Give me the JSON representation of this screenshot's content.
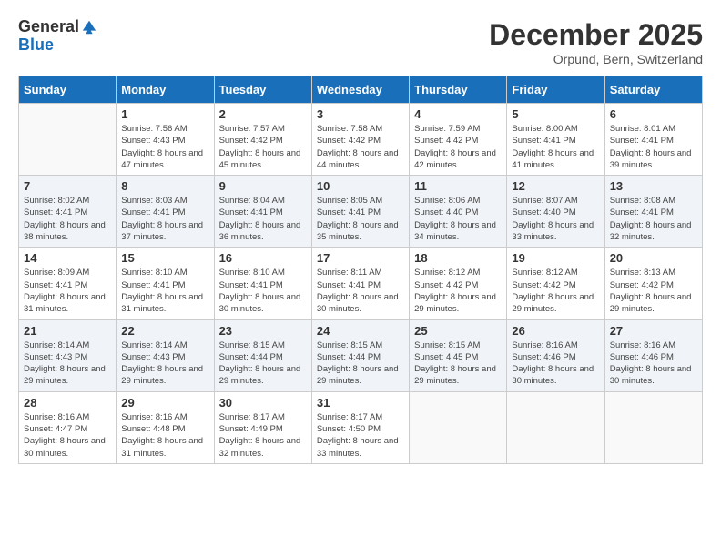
{
  "logo": {
    "general": "General",
    "blue": "Blue"
  },
  "title": "December 2025",
  "location": "Orpund, Bern, Switzerland",
  "days_of_week": [
    "Sunday",
    "Monday",
    "Tuesday",
    "Wednesday",
    "Thursday",
    "Friday",
    "Saturday"
  ],
  "weeks": [
    [
      {
        "day": "",
        "sunrise": "",
        "sunset": "",
        "daylight": ""
      },
      {
        "day": "1",
        "sunrise": "Sunrise: 7:56 AM",
        "sunset": "Sunset: 4:43 PM",
        "daylight": "Daylight: 8 hours and 47 minutes."
      },
      {
        "day": "2",
        "sunrise": "Sunrise: 7:57 AM",
        "sunset": "Sunset: 4:42 PM",
        "daylight": "Daylight: 8 hours and 45 minutes."
      },
      {
        "day": "3",
        "sunrise": "Sunrise: 7:58 AM",
        "sunset": "Sunset: 4:42 PM",
        "daylight": "Daylight: 8 hours and 44 minutes."
      },
      {
        "day": "4",
        "sunrise": "Sunrise: 7:59 AM",
        "sunset": "Sunset: 4:42 PM",
        "daylight": "Daylight: 8 hours and 42 minutes."
      },
      {
        "day": "5",
        "sunrise": "Sunrise: 8:00 AM",
        "sunset": "Sunset: 4:41 PM",
        "daylight": "Daylight: 8 hours and 41 minutes."
      },
      {
        "day": "6",
        "sunrise": "Sunrise: 8:01 AM",
        "sunset": "Sunset: 4:41 PM",
        "daylight": "Daylight: 8 hours and 39 minutes."
      }
    ],
    [
      {
        "day": "7",
        "sunrise": "Sunrise: 8:02 AM",
        "sunset": "Sunset: 4:41 PM",
        "daylight": "Daylight: 8 hours and 38 minutes."
      },
      {
        "day": "8",
        "sunrise": "Sunrise: 8:03 AM",
        "sunset": "Sunset: 4:41 PM",
        "daylight": "Daylight: 8 hours and 37 minutes."
      },
      {
        "day": "9",
        "sunrise": "Sunrise: 8:04 AM",
        "sunset": "Sunset: 4:41 PM",
        "daylight": "Daylight: 8 hours and 36 minutes."
      },
      {
        "day": "10",
        "sunrise": "Sunrise: 8:05 AM",
        "sunset": "Sunset: 4:41 PM",
        "daylight": "Daylight: 8 hours and 35 minutes."
      },
      {
        "day": "11",
        "sunrise": "Sunrise: 8:06 AM",
        "sunset": "Sunset: 4:40 PM",
        "daylight": "Daylight: 8 hours and 34 minutes."
      },
      {
        "day": "12",
        "sunrise": "Sunrise: 8:07 AM",
        "sunset": "Sunset: 4:40 PM",
        "daylight": "Daylight: 8 hours and 33 minutes."
      },
      {
        "day": "13",
        "sunrise": "Sunrise: 8:08 AM",
        "sunset": "Sunset: 4:41 PM",
        "daylight": "Daylight: 8 hours and 32 minutes."
      }
    ],
    [
      {
        "day": "14",
        "sunrise": "Sunrise: 8:09 AM",
        "sunset": "Sunset: 4:41 PM",
        "daylight": "Daylight: 8 hours and 31 minutes."
      },
      {
        "day": "15",
        "sunrise": "Sunrise: 8:10 AM",
        "sunset": "Sunset: 4:41 PM",
        "daylight": "Daylight: 8 hours and 31 minutes."
      },
      {
        "day": "16",
        "sunrise": "Sunrise: 8:10 AM",
        "sunset": "Sunset: 4:41 PM",
        "daylight": "Daylight: 8 hours and 30 minutes."
      },
      {
        "day": "17",
        "sunrise": "Sunrise: 8:11 AM",
        "sunset": "Sunset: 4:41 PM",
        "daylight": "Daylight: 8 hours and 30 minutes."
      },
      {
        "day": "18",
        "sunrise": "Sunrise: 8:12 AM",
        "sunset": "Sunset: 4:42 PM",
        "daylight": "Daylight: 8 hours and 29 minutes."
      },
      {
        "day": "19",
        "sunrise": "Sunrise: 8:12 AM",
        "sunset": "Sunset: 4:42 PM",
        "daylight": "Daylight: 8 hours and 29 minutes."
      },
      {
        "day": "20",
        "sunrise": "Sunrise: 8:13 AM",
        "sunset": "Sunset: 4:42 PM",
        "daylight": "Daylight: 8 hours and 29 minutes."
      }
    ],
    [
      {
        "day": "21",
        "sunrise": "Sunrise: 8:14 AM",
        "sunset": "Sunset: 4:43 PM",
        "daylight": "Daylight: 8 hours and 29 minutes."
      },
      {
        "day": "22",
        "sunrise": "Sunrise: 8:14 AM",
        "sunset": "Sunset: 4:43 PM",
        "daylight": "Daylight: 8 hours and 29 minutes."
      },
      {
        "day": "23",
        "sunrise": "Sunrise: 8:15 AM",
        "sunset": "Sunset: 4:44 PM",
        "daylight": "Daylight: 8 hours and 29 minutes."
      },
      {
        "day": "24",
        "sunrise": "Sunrise: 8:15 AM",
        "sunset": "Sunset: 4:44 PM",
        "daylight": "Daylight: 8 hours and 29 minutes."
      },
      {
        "day": "25",
        "sunrise": "Sunrise: 8:15 AM",
        "sunset": "Sunset: 4:45 PM",
        "daylight": "Daylight: 8 hours and 29 minutes."
      },
      {
        "day": "26",
        "sunrise": "Sunrise: 8:16 AM",
        "sunset": "Sunset: 4:46 PM",
        "daylight": "Daylight: 8 hours and 30 minutes."
      },
      {
        "day": "27",
        "sunrise": "Sunrise: 8:16 AM",
        "sunset": "Sunset: 4:46 PM",
        "daylight": "Daylight: 8 hours and 30 minutes."
      }
    ],
    [
      {
        "day": "28",
        "sunrise": "Sunrise: 8:16 AM",
        "sunset": "Sunset: 4:47 PM",
        "daylight": "Daylight: 8 hours and 30 minutes."
      },
      {
        "day": "29",
        "sunrise": "Sunrise: 8:16 AM",
        "sunset": "Sunset: 4:48 PM",
        "daylight": "Daylight: 8 hours and 31 minutes."
      },
      {
        "day": "30",
        "sunrise": "Sunrise: 8:17 AM",
        "sunset": "Sunset: 4:49 PM",
        "daylight": "Daylight: 8 hours and 32 minutes."
      },
      {
        "day": "31",
        "sunrise": "Sunrise: 8:17 AM",
        "sunset": "Sunset: 4:50 PM",
        "daylight": "Daylight: 8 hours and 33 minutes."
      },
      {
        "day": "",
        "sunrise": "",
        "sunset": "",
        "daylight": ""
      },
      {
        "day": "",
        "sunrise": "",
        "sunset": "",
        "daylight": ""
      },
      {
        "day": "",
        "sunrise": "",
        "sunset": "",
        "daylight": ""
      }
    ]
  ]
}
